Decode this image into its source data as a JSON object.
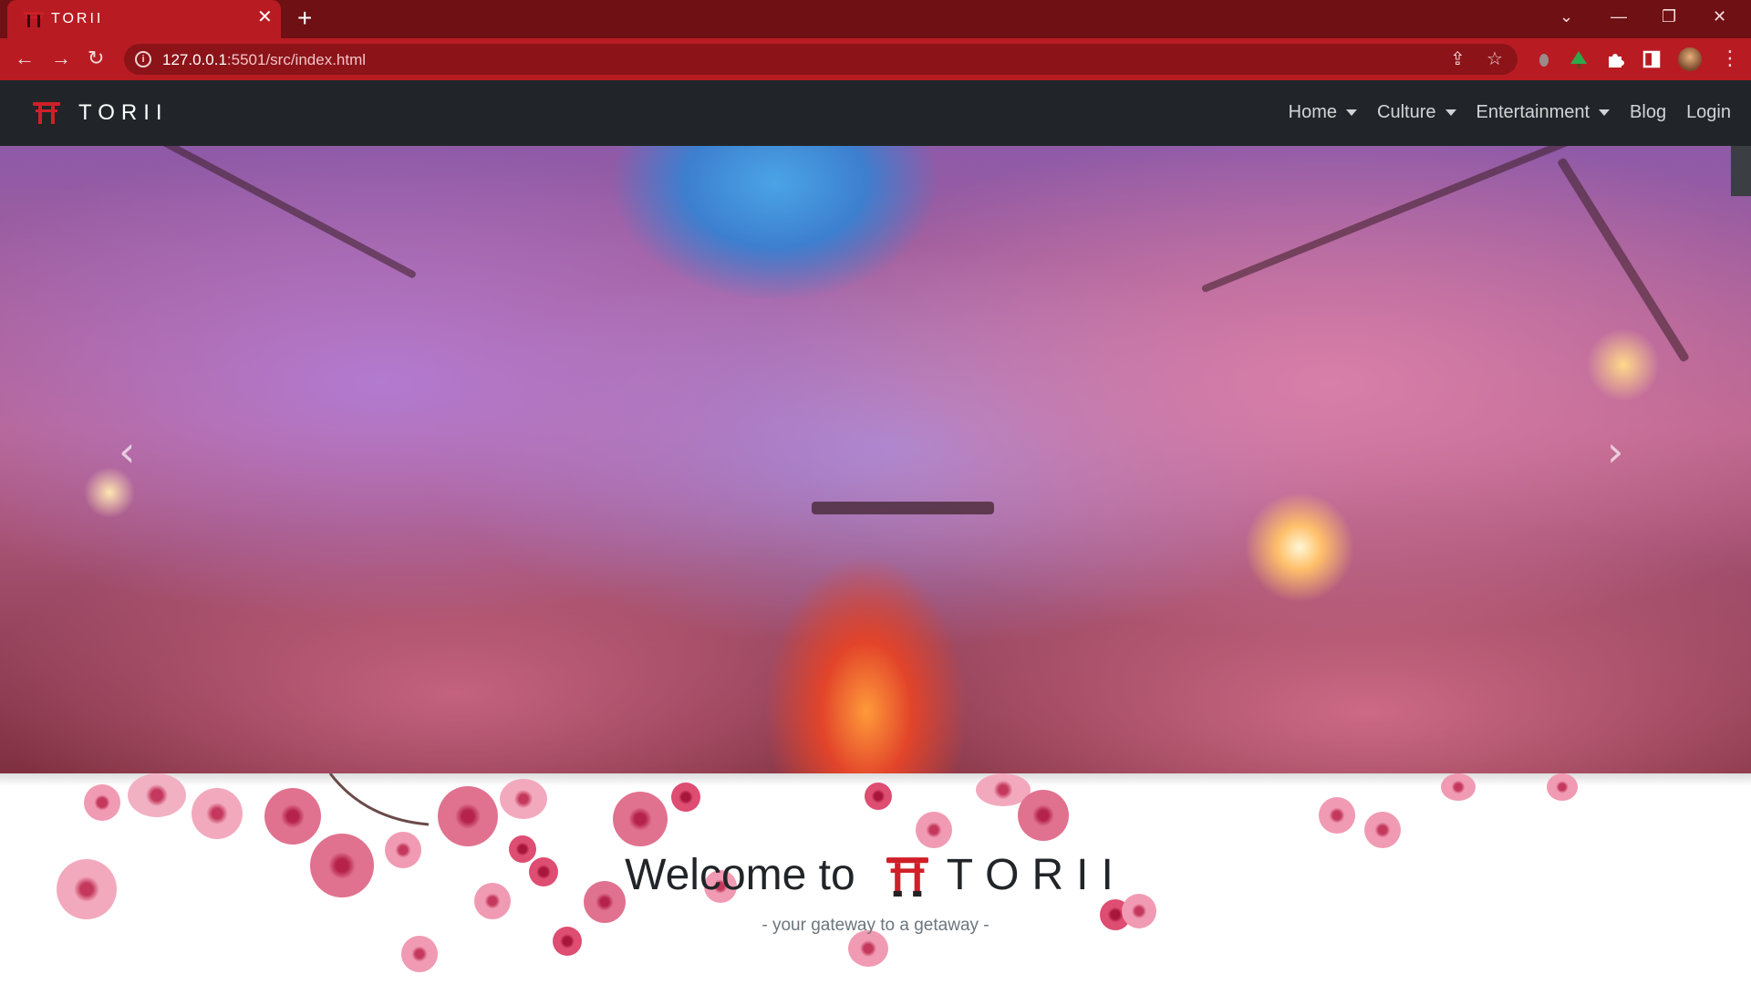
{
  "browser": {
    "tab_title": "TORII",
    "url_host": "127.0.0.1",
    "url_path": ":5501/src/index.html",
    "accent": "#b81c22"
  },
  "site": {
    "brand": "TORII",
    "nav": [
      {
        "label": "Home",
        "dropdown": true
      },
      {
        "label": "Culture",
        "dropdown": true
      },
      {
        "label": "Entertainment",
        "dropdown": true
      },
      {
        "label": "Blog",
        "dropdown": false
      },
      {
        "label": "Login",
        "dropdown": false
      }
    ],
    "nav_bg": "#212529"
  },
  "hero": {
    "image": "cherry-blossom-river-night",
    "prev_icon": "chevron-left-icon",
    "next_icon": "chevron-right-icon"
  },
  "welcome": {
    "heading": "Welcome to",
    "brand": "TORII",
    "tagline": "- your gateway to a getaway -"
  }
}
